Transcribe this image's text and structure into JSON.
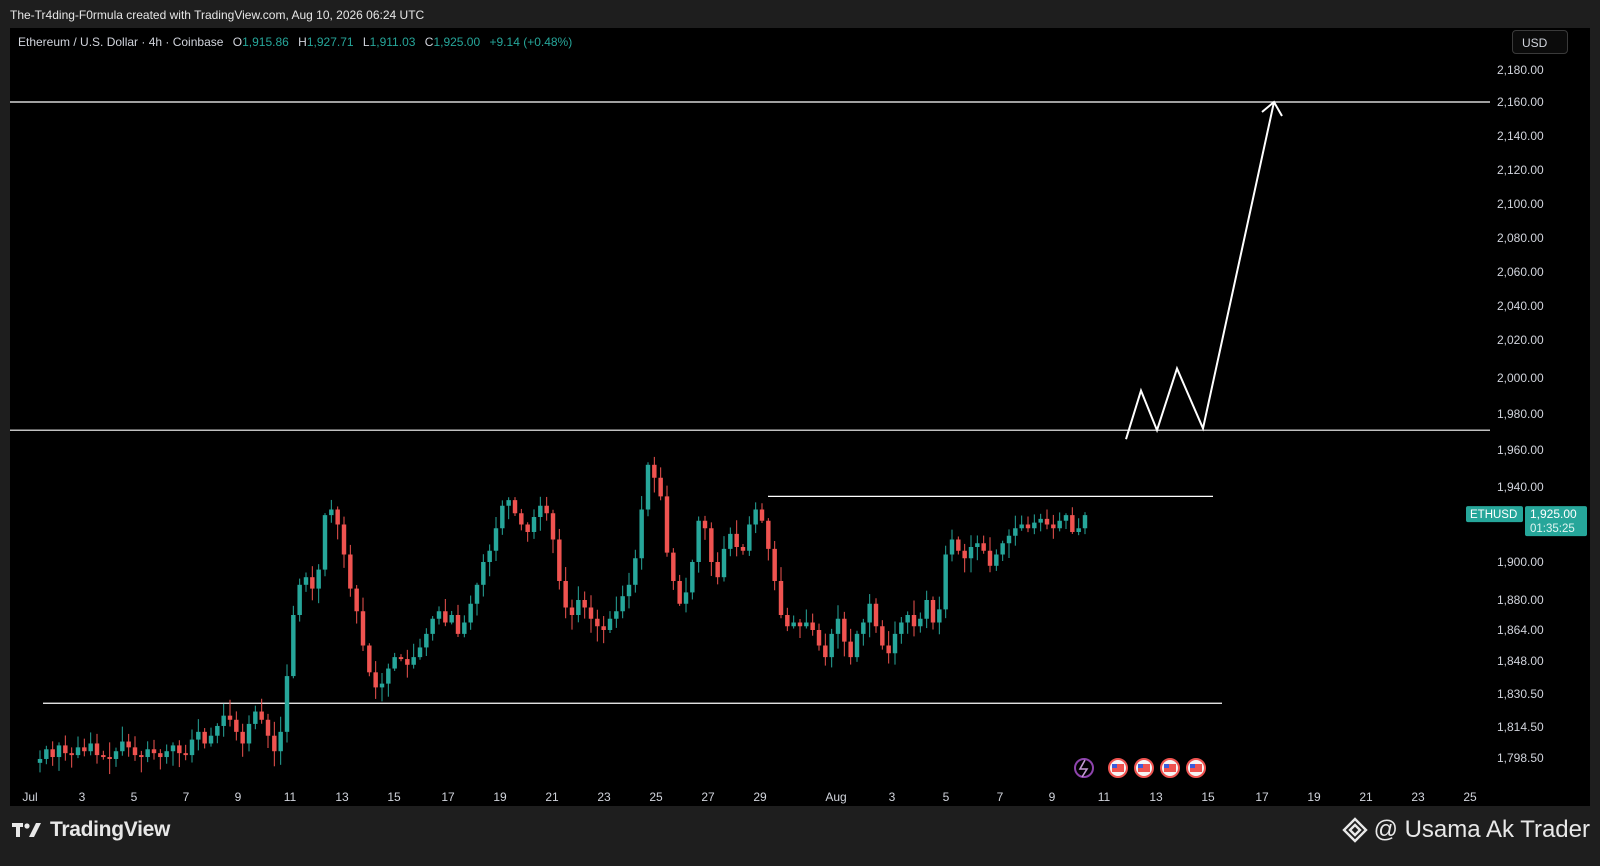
{
  "attribution": "The-Tr4ding-F0rmula created with TradingView.com, Aug 10, 2026 06:24 UTC",
  "legend": {
    "symbol": "Ethereum / U.S. Dollar · 4h · Coinbase",
    "o_label": "O",
    "o_value": "1,915.86",
    "h_label": "H",
    "h_value": "1,927.71",
    "l_label": "L",
    "l_value": "1,911.03",
    "c_label": "C",
    "c_value": "1,925.00",
    "change": "+9.14 (+0.48%)"
  },
  "currency_button": "USD",
  "price_label": {
    "ticker": "ETHUSD",
    "price": "1,925.00",
    "countdown": "01:35:25"
  },
  "footer": {
    "brand": "TradingView",
    "author": "@ Usama Ak Trader"
  },
  "colors": {
    "background": "#000000",
    "up": "#26a69a",
    "down": "#ef5350",
    "lines": "#ffffff",
    "text": "#d1d4dc"
  },
  "chart_data": {
    "type": "candlestick",
    "symbol": "ETHUSD",
    "timeframe": "4h",
    "y_axis_ticks": [
      "2,180.00",
      "2,160.00",
      "2,140.00",
      "2,120.00",
      "2,100.00",
      "2,080.00",
      "2,060.00",
      "2,040.00",
      "2,020.00",
      "2,000.00",
      "1,980.00",
      "1,960.00",
      "1,940.00",
      "1,900.00",
      "1,880.00",
      "1,864.00",
      "1,848.00",
      "1,830.50",
      "1,814.50",
      "1,798.50"
    ],
    "x_axis_ticks": [
      "Jul",
      "3",
      "5",
      "7",
      "9",
      "11",
      "13",
      "15",
      "17",
      "19",
      "21",
      "23",
      "25",
      "27",
      "29",
      "Aug",
      "3",
      "5",
      "7",
      "9",
      "11",
      "13",
      "15",
      "17",
      "19",
      "21",
      "23",
      "25"
    ],
    "horizontal_lines": [
      {
        "price": 2160
      },
      {
        "price": 1971
      },
      {
        "price": 1935
      },
      {
        "price": 1826
      }
    ],
    "projection_path": [
      1966,
      1993,
      1971,
      2005,
      1972,
      2160
    ],
    "last_price": 1925.0,
    "closes": [
      1798,
      1803,
      1799,
      1805,
      1801,
      1800,
      1804,
      1802,
      1806,
      1800,
      1799,
      1798,
      1802,
      1807,
      1804,
      1800,
      1799,
      1803,
      1801,
      1799,
      1802,
      1805,
      1801,
      1800,
      1808,
      1812,
      1806,
      1810,
      1815,
      1820,
      1818,
      1812,
      1806,
      1816,
      1822,
      1818,
      1810,
      1802,
      1812,
      1840,
      1872,
      1888,
      1892,
      1886,
      1896,
      1925,
      1928,
      1920,
      1904,
      1886,
      1874,
      1856,
      1842,
      1834,
      1836,
      1844,
      1850,
      1849,
      1846,
      1850,
      1855,
      1862,
      1870,
      1874,
      1868,
      1872,
      1862,
      1868,
      1878,
      1888,
      1900,
      1906,
      1918,
      1930,
      1933,
      1926,
      1920,
      1916,
      1924,
      1930,
      1926,
      1912,
      1890,
      1876,
      1872,
      1880,
      1876,
      1870,
      1866,
      1864,
      1870,
      1874,
      1882,
      1888,
      1902,
      1928,
      1952,
      1945,
      1935,
      1905,
      1890,
      1878,
      1884,
      1900,
      1922,
      1918,
      1900,
      1892,
      1907,
      1915,
      1908,
      1906,
      1920,
      1928,
      1922,
      1907,
      1890,
      1872,
      1866,
      1868,
      1866,
      1868,
      1864,
      1856,
      1850,
      1862,
      1870,
      1858,
      1850,
      1862,
      1868,
      1878,
      1866,
      1856,
      1852,
      1862,
      1868,
      1872,
      1866,
      1870,
      1880,
      1868,
      1875,
      1904,
      1912,
      1906,
      1902,
      1908,
      1910,
      1906,
      1898,
      1904,
      1910,
      1914,
      1918,
      1920,
      1918,
      1921,
      1923,
      1920,
      1918,
      1922,
      1925,
      1916,
      1918,
      1925
    ]
  }
}
